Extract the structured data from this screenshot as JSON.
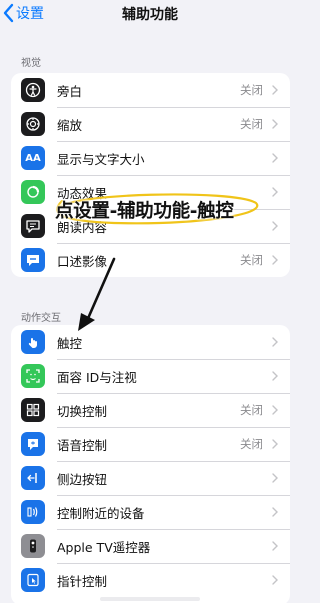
{
  "nav": {
    "back_label": "设置",
    "title": "辅助功能"
  },
  "sections": {
    "vision": {
      "header": "视觉",
      "items": [
        {
          "label": "旁白",
          "value": "关闭",
          "icon": "voiceover-icon",
          "color": "#1c1c1e"
        },
        {
          "label": "缩放",
          "value": "关闭",
          "icon": "zoom-icon",
          "color": "#1c1c1e"
        },
        {
          "label": "显示与文字大小",
          "value": "",
          "icon": "text-size-icon",
          "color": "#1a73e8"
        },
        {
          "label": "动态效果",
          "value": "",
          "icon": "motion-icon",
          "color": "#34c759"
        },
        {
          "label": "朗读内容",
          "value": "",
          "icon": "speech-bubble-icon",
          "color": "#1c1c1e"
        },
        {
          "label": "口述影像",
          "value": "关闭",
          "icon": "audio-description-icon",
          "color": "#1a73e8"
        }
      ]
    },
    "interaction": {
      "header": "动作交互",
      "items": [
        {
          "label": "触控",
          "value": "",
          "icon": "touch-hand-icon",
          "color": "#1a73e8"
        },
        {
          "label": "面容 ID与注视",
          "value": "",
          "icon": "face-id-icon",
          "color": "#34c759"
        },
        {
          "label": "切换控制",
          "value": "关闭",
          "icon": "switch-control-icon",
          "color": "#1c1c1e"
        },
        {
          "label": "语音控制",
          "value": "关闭",
          "icon": "voice-control-icon",
          "color": "#1a73e8"
        },
        {
          "label": "侧边按钮",
          "value": "",
          "icon": "side-button-icon",
          "color": "#1a73e8"
        },
        {
          "label": "控制附近的设备",
          "value": "",
          "icon": "nearby-devices-icon",
          "color": "#1a73e8"
        },
        {
          "label": "Apple TV遥控器",
          "value": "",
          "icon": "remote-icon",
          "color": "#8e8e93"
        },
        {
          "label": "指针控制",
          "value": "",
          "icon": "pointer-icon",
          "color": "#1a73e8"
        }
      ]
    }
  },
  "annotation": {
    "text": "点设置-辅助功能-触控"
  }
}
